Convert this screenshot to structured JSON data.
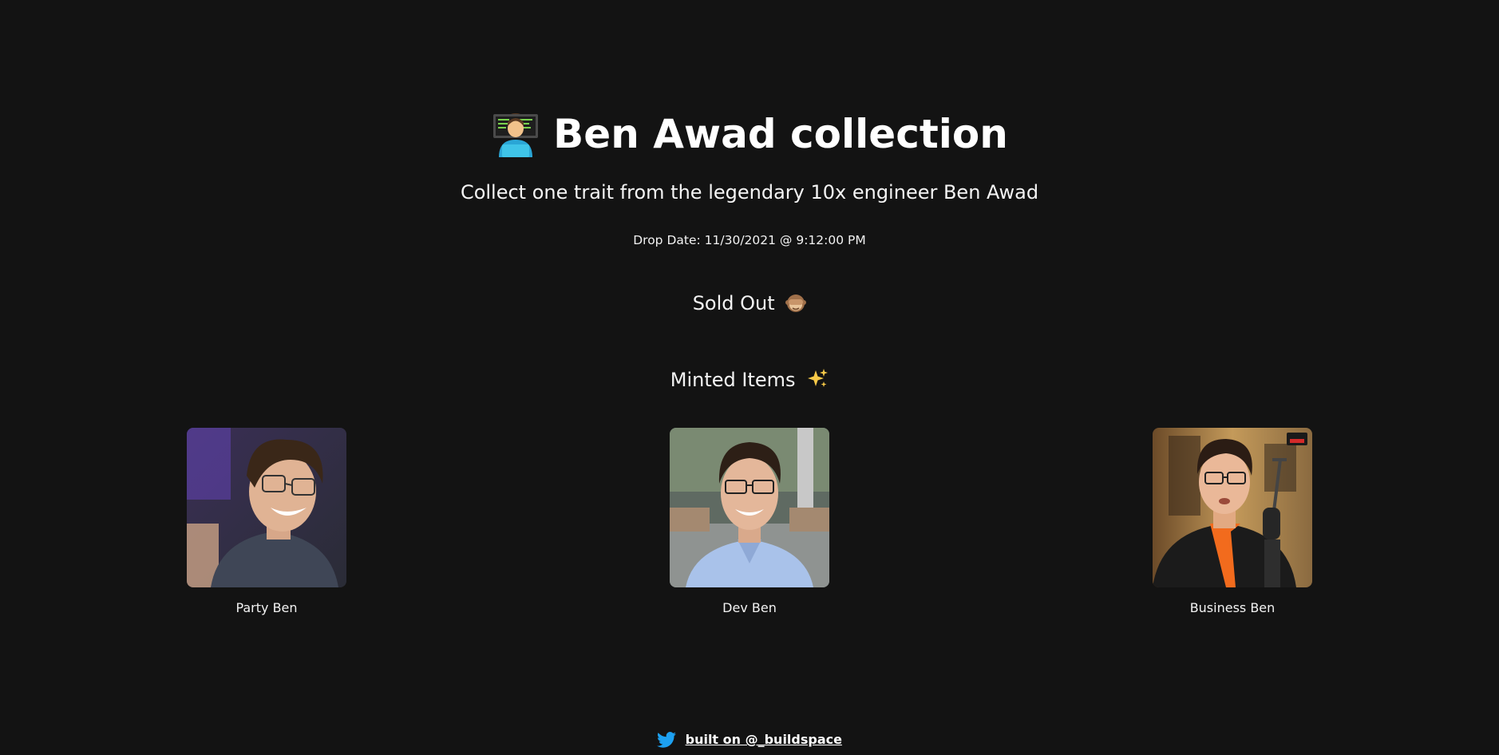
{
  "header": {
    "title_icon": "technologist-emoji-icon",
    "title": "Ben Awad collection",
    "subtitle": "Collect one trait from the legendary 10x engineer Ben Awad"
  },
  "drop": {
    "date_text": "Drop Date: 11/30/2021 @ 9:12:00 PM"
  },
  "status": {
    "label": "Sold Out",
    "icon": "see-no-evil-monkey-emoji-icon"
  },
  "minted": {
    "heading": "Minted Items",
    "icon": "sparkles-emoji-icon",
    "items": [
      {
        "label": "Party Ben",
        "icon": "party-ben-portrait"
      },
      {
        "label": "Dev Ben",
        "icon": "dev-ben-portrait"
      },
      {
        "label": "Business Ben",
        "icon": "business-ben-portrait"
      }
    ]
  },
  "footer": {
    "icon": "twitter-bird-icon",
    "link_text": "built on @_buildspace"
  },
  "colors": {
    "background": "#131313",
    "text": "#ffffff",
    "twitter_blue": "#1da1f2"
  }
}
